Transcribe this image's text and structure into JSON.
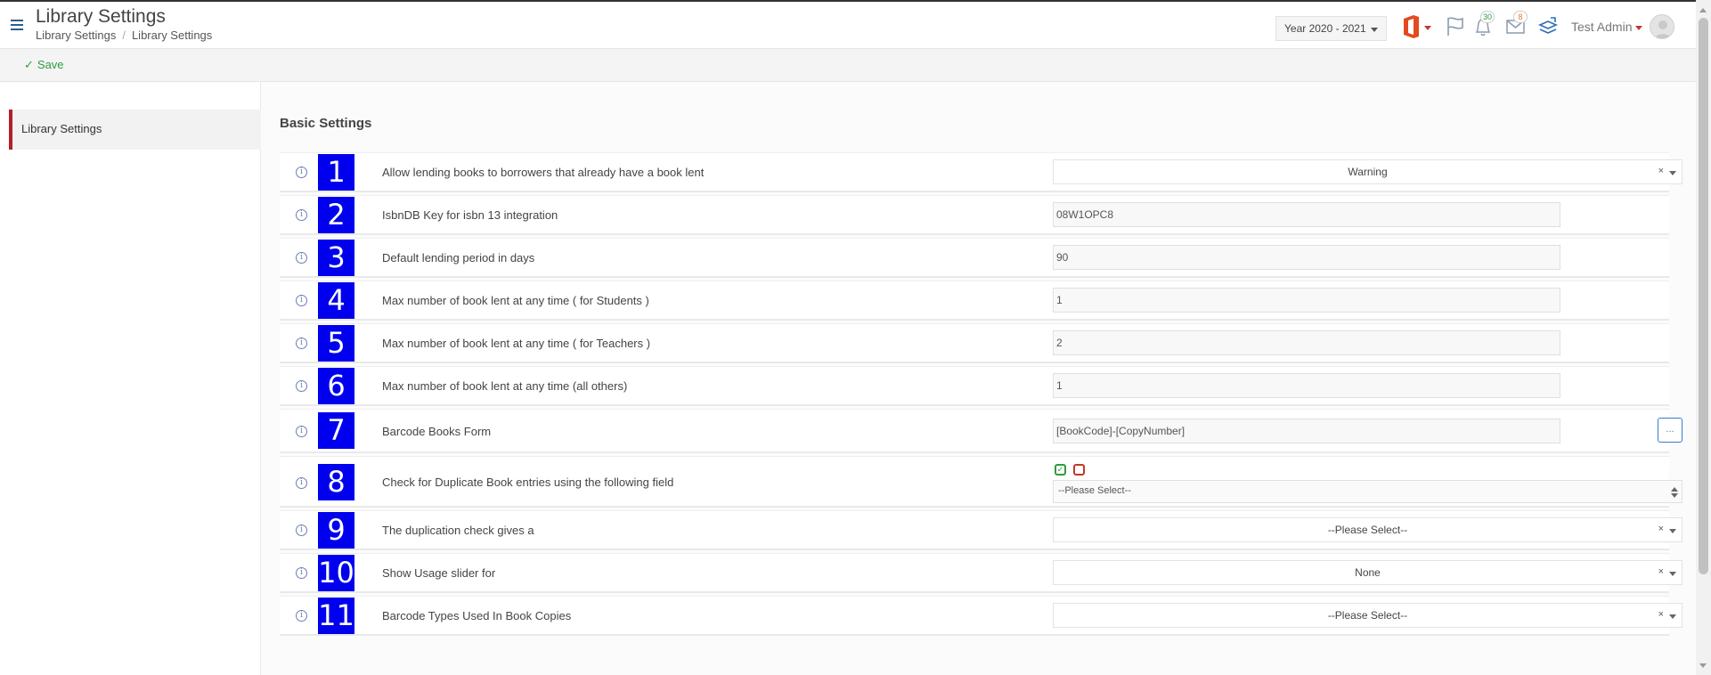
{
  "header": {
    "title": "Library Settings",
    "breadcrumb": [
      "Library Settings",
      "Library Settings"
    ],
    "year": "Year 2020 - 2021",
    "notifications_count": "30",
    "messages_count": "8",
    "user_name": "Test Admin"
  },
  "toolbar": {
    "save_label": "Save"
  },
  "sidebar": {
    "items": [
      {
        "label": "Library Settings"
      }
    ]
  },
  "main": {
    "section_title": "Basic Settings",
    "rows": [
      {
        "number": "1",
        "label": "Allow lending books to borrowers that already have a book lent",
        "type": "select",
        "value": "Warning"
      },
      {
        "number": "2",
        "label": "IsbnDB Key for isbn 13 integration",
        "type": "input",
        "value": "08W1OPC8"
      },
      {
        "number": "3",
        "label": "Default lending period in days",
        "type": "input",
        "value": "90"
      },
      {
        "number": "4",
        "label": "Max number of book lent at any time ( for Students )",
        "type": "input",
        "value": "1"
      },
      {
        "number": "5",
        "label": "Max number of book lent at any time ( for Teachers )",
        "type": "input",
        "value": "2"
      },
      {
        "number": "6",
        "label": "Max number of book lent at any time (all others)",
        "type": "input",
        "value": "1"
      },
      {
        "number": "7",
        "label": "Barcode Books Form",
        "type": "input-button",
        "value": "[BookCode]-[CopyNumber]",
        "button_label": "..."
      },
      {
        "number": "8",
        "label": "Check for Duplicate Book entries using the following field",
        "type": "multiselect",
        "value": "--Please Select--"
      },
      {
        "number": "9",
        "label": "The duplication check gives a",
        "type": "select",
        "value": "--Please Select--"
      },
      {
        "number": "10",
        "label": "Show Usage slider for",
        "type": "select",
        "value": "None"
      },
      {
        "number": "11",
        "label": "Barcode Types Used In Book Copies",
        "type": "select",
        "value": "--Please Select--"
      }
    ]
  },
  "colors": {
    "accent_red": "#b3202a",
    "number_badge": "#0000ee",
    "save_green": "#2e9c3f"
  },
  "icons": [
    "hamburger-icon",
    "office-icon",
    "flag-icon",
    "bell-icon",
    "envelope-icon",
    "sync-icon",
    "info-icon",
    "check-icon"
  ]
}
